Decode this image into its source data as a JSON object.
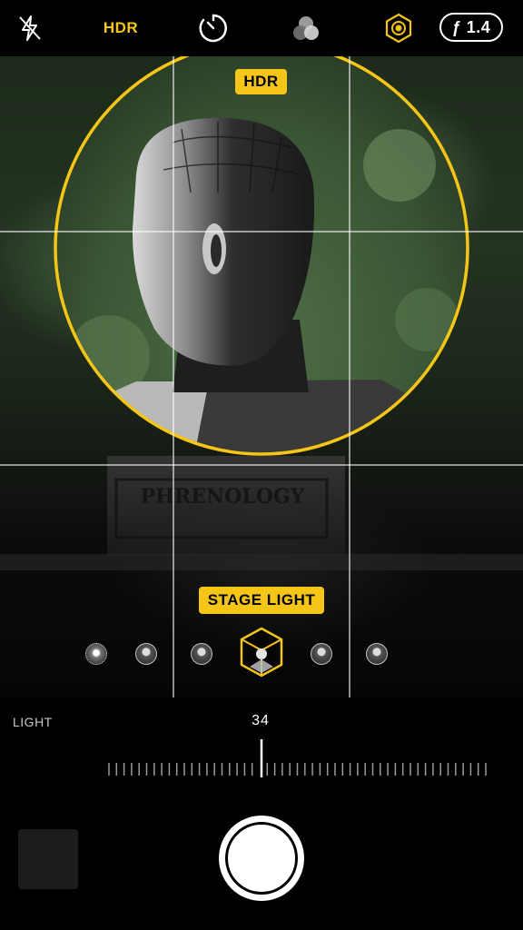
{
  "top_bar": {
    "flash_icon": "flash-off-icon",
    "hdr_label": "HDR",
    "timer_icon": "timer-icon",
    "filters_icon": "filters-icon",
    "live_photo_icon": "live-photo-icon",
    "aperture_label": "ƒ 1.4"
  },
  "viewfinder": {
    "hdr_badge": "HDR",
    "effect_badge": "STAGE LIGHT",
    "subject_text": "PHRENOLOGY",
    "effects": [
      {
        "name": "natural-light",
        "selected": false
      },
      {
        "name": "studio-light",
        "selected": false
      },
      {
        "name": "contour-light",
        "selected": false
      },
      {
        "name": "stage-light",
        "selected": true
      },
      {
        "name": "stage-light-mono",
        "selected": false
      },
      {
        "name": "high-key-light-mono",
        "selected": false
      }
    ]
  },
  "light_control": {
    "label": "LIGHT",
    "value": "34"
  },
  "colors": {
    "accent": "#f5c518",
    "background": "#000000"
  }
}
